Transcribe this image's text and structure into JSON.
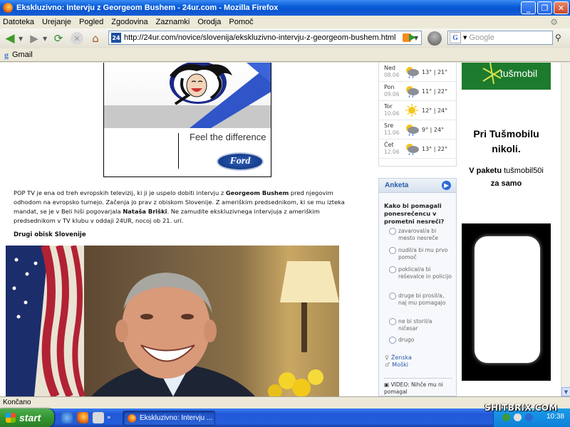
{
  "window": {
    "title": "Ekskluzivno: Intervju z Georgeom Bushem - 24ur.com - Mozilla Firefox",
    "minimize": "_",
    "maximize": "❐",
    "close": "✕"
  },
  "menu": [
    "Datoteka",
    "Urejanje",
    "Pogled",
    "Zgodovina",
    "Zaznamki",
    "Orodja",
    "Pomoč"
  ],
  "toolbar": {
    "url": "http://24ur.com/novice/slovenija/ekskluzivno-intervju-z-georgeom-bushem.html",
    "url_favicon": "24",
    "search_placeholder": "Google"
  },
  "bookmarks": {
    "gmail_label": "Gmail"
  },
  "ford_ad": {
    "tagline": "Feel the difference",
    "logo": "Ford"
  },
  "article": {
    "paragraph_parts": [
      "POP TV je ena od treh evropskih televizij, ki ji je uspelo dobiti intervju z ",
      "Georgeom Bushem",
      " pred njegovim odhodom na evropsko turnejo. Začenja jo prav z obiskom Slovenije. Z ameriškim predsednikom, ki se mu izteka mandat, se je v Beli hiši pogovarjala ",
      "Nataša Briški",
      ". Ne zamudite ekskluzivnega intervjuja z ameriškim predsednikom v TV klubu v oddaji 24UR, nocoj ob 21. uri."
    ],
    "subheading": "Drugi obisk Slovenije"
  },
  "weather": [
    {
      "day": "Ned",
      "date": "08.06",
      "temp": "13° | 21°",
      "icon": "rain-cloud-icon"
    },
    {
      "day": "Pon",
      "date": "09.06",
      "temp": "11° | 22°",
      "icon": "rain-cloud-icon"
    },
    {
      "day": "Tor",
      "date": "10.06",
      "temp": "12° | 24°",
      "icon": "sun-icon"
    },
    {
      "day": "Sre",
      "date": "11.06",
      "temp": "9° | 24°",
      "icon": "rain-cloud-icon"
    },
    {
      "day": "Čet",
      "date": "12.06",
      "temp": "13° | 22°",
      "icon": "rain-cloud-icon"
    }
  ],
  "poll": {
    "title": "Anketa",
    "question": "Kako bi pomagali ponesrečencu v prometni nesreči?",
    "options": [
      "zavaroval/a bi mesto nesreče",
      "nudil/a bi mu prvo pomoč",
      "poklical/a bi reševalce in policijo",
      "druge bi prosil/a, naj mu pomagajo",
      "ne bi storil/a ničesar",
      "drugo"
    ],
    "female": "Ženska",
    "male": "Moški",
    "video": "VIDEO: Nihče mu ni pomagal"
  },
  "tus_ad": {
    "brand": "tušmobil",
    "line1": "Pri Tušmobilu",
    "line2": "nikoli.",
    "line3_prefix": "V paketu ",
    "line3_brand": "tušmobil50i",
    "line4": "za samo"
  },
  "status": "Končano",
  "taskbar": {
    "start": "start",
    "task": "Ekskluzivno: Intervju ...",
    "clock": "10:38"
  },
  "watermark": "SHITBRIX.COM",
  "colors": {
    "accent_blue": "#2a5aa8",
    "tus_green": "#1d7b2d",
    "xp_title": "#0753d1"
  }
}
